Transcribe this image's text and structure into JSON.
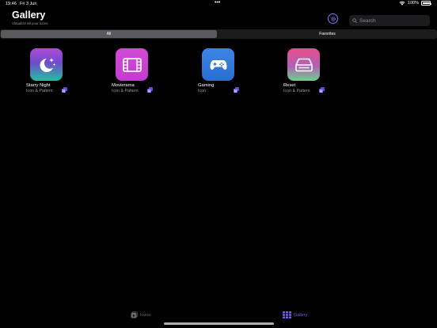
{
  "status_bar": {
    "time": "19:46",
    "date": "Fri 3 Jun",
    "dots": "•••",
    "battery": "100%",
    "battery_level": 1.0
  },
  "header": {
    "title": "Gallery",
    "subtitle": "Visualize all your icons"
  },
  "search": {
    "placeholder": "Search",
    "value": ""
  },
  "segments": {
    "all_label": "All",
    "favorites_label": "Favorites",
    "selected": "All"
  },
  "items": [
    {
      "name": "Starry Night",
      "type": "Icon & Pattern",
      "icon": "moon-stars-icon"
    },
    {
      "name": "Movierama",
      "type": "Icon & Pattern",
      "icon": "film-icon"
    },
    {
      "name": "Gaming",
      "type": "Icon",
      "icon": "gamecontroller-icon"
    },
    {
      "name": "Reset",
      "type": "Icon & Pattern",
      "icon": "drive-icon"
    }
  ],
  "tab_bar": {
    "icons_label": "Icons",
    "gallery_label": "Gallery",
    "selected": "Gallery"
  },
  "colors": {
    "accent": "#7a5cf0",
    "background": "#000000"
  }
}
